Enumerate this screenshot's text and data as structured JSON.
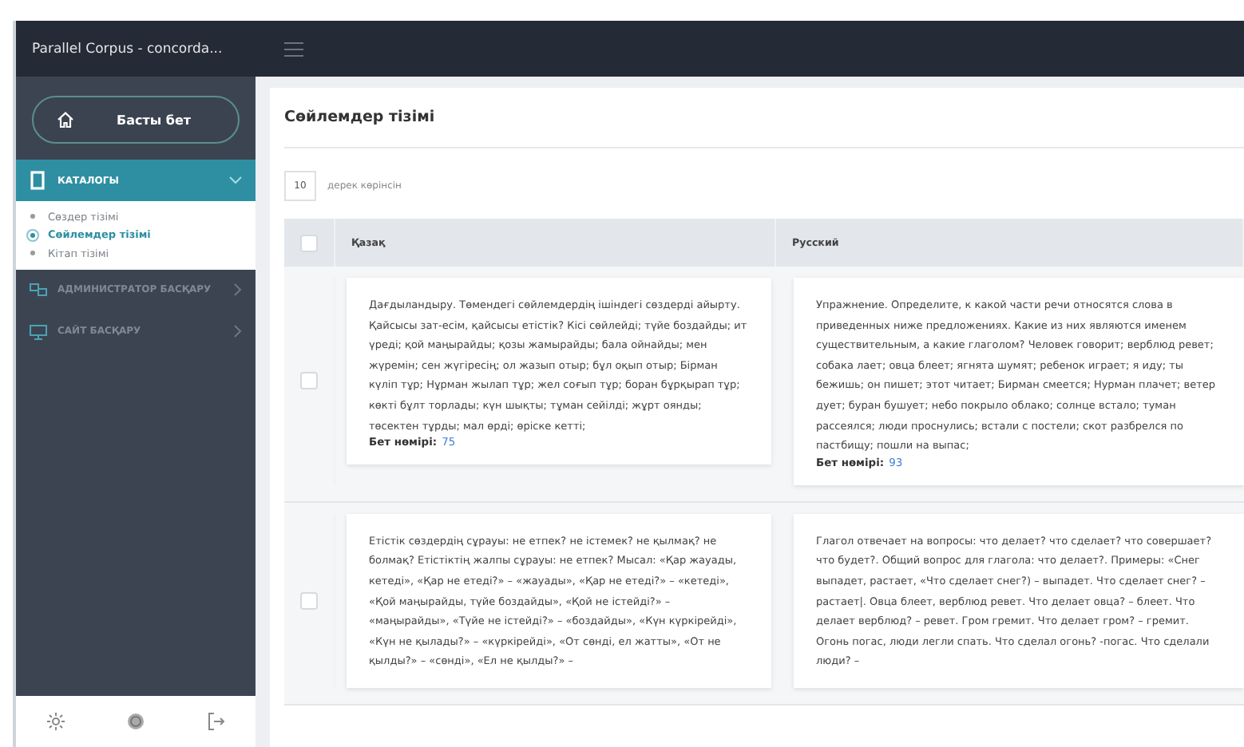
{
  "app_title": "Parallel Corpus - concorda...",
  "sidebar": {
    "home_button": "Басты бет",
    "groups": [
      {
        "label": "КАТАЛОГЫ",
        "selected": true,
        "expanded": true,
        "children": [
          {
            "label": "Сөздер тізімі",
            "selected": false
          },
          {
            "label": "Сөйлемдер тізімі",
            "selected": true
          },
          {
            "label": "Кітап тізімі",
            "selected": false
          }
        ]
      },
      {
        "label": "АДМИНИСТРАТОР БАСҚАРУ",
        "selected": false,
        "expanded": false
      },
      {
        "label": "САЙТ БАСҚАРУ",
        "selected": false,
        "expanded": false
      }
    ]
  },
  "page": {
    "title": "Сөйлемдер тізімі",
    "page_size": "10",
    "page_size_label": "дерек көрінсін",
    "table": {
      "header_checked": false,
      "columns": [
        "Қазақ",
        "Русский"
      ],
      "rows": [
        {
          "checked": false,
          "cells": [
            {
              "text": "Дағдыландыру. Төмендегі сөйлемдердің ішіндегі сөздерді айырту. Қайсысы зат-есім, қайсысы етістік? Кісі сөйлейді; түйе боздайды; ит үреді; қой маңырайды; қозы жамырайды; бала ойнайды; мен жүремін; сен жүгіресің; ол жазып отыр; бұл оқып отыр; Бірман күліп тұр; Нұрман жылап тұр; жел соғып тұр; боран бұрқырап тұр; көкті бұлт торлады; күн шықты; тұман сейілді; жұрт оянды; төсектен тұрды; мал өрді; өріске кетті;",
              "page_label": "Бет нөмірі:",
              "page_number": "75"
            },
            {
              "text": "Упражнение. Определите, к какой части речи относятся слова в приведенных ниже предложениях. Какие из них являются именем существительным, а какие глаголом? Человек говорит; верблюд ревет; собака лает; овца блеет; ягнята шумят; ребенок играет; я иду; ты бежишь; он пишет; этот читает; Бирман смеется; Нурман плачет; ветер дует; буран бушует; небо покрыло облако; солнце встало; туман рассеялся; люди проснулись; встали с постели; скот разбрелся по пастбищу; пошли на выпас;",
              "page_label": "Бет нөмірі:",
              "page_number": "93"
            }
          ]
        },
        {
          "checked": false,
          "cells": [
            {
              "text": "Етістік сөздердің сұрауы: не етпек? не істемек? не қылмақ? не болмақ? Етістіктің жалпы сұрауы: не етпек? Мысал: «Қар жауады, кетеді», «Қар не етеді?» – «жауады», «Қар не етеді?» – «кетеді», «Қой маңырайды, түйе боздайды», «Қой не істейді?» – «маңырайды», «Түйе не істейді?» – «боздайды», «Күн күркірейді», «Күн не қылады?» – «күркірейді», «От сөнді, ел жатты», «От не қылды?» – «сөнді», «Ел не қылды?» –"
            },
            {
              "text": "Глагол отвечает на вопросы: что делает? что сделает? что совершает? что будет?. Общий вопрос для глагола: что делает?. Примеры: «Снег выпадет, растает, «Что сделает снег?) – выпадет. Что сделает снег? – растает|. Овца блеет, верблюд ревет. Что делает овца? – блеет. Что делает верблюд? – ревет. Гром гремит. Что делает гром? – гремит. Огонь погас, люди легли спать. Что сделал огонь? -погас. Что сделали люди? –"
            }
          ]
        }
      ]
    }
  }
}
